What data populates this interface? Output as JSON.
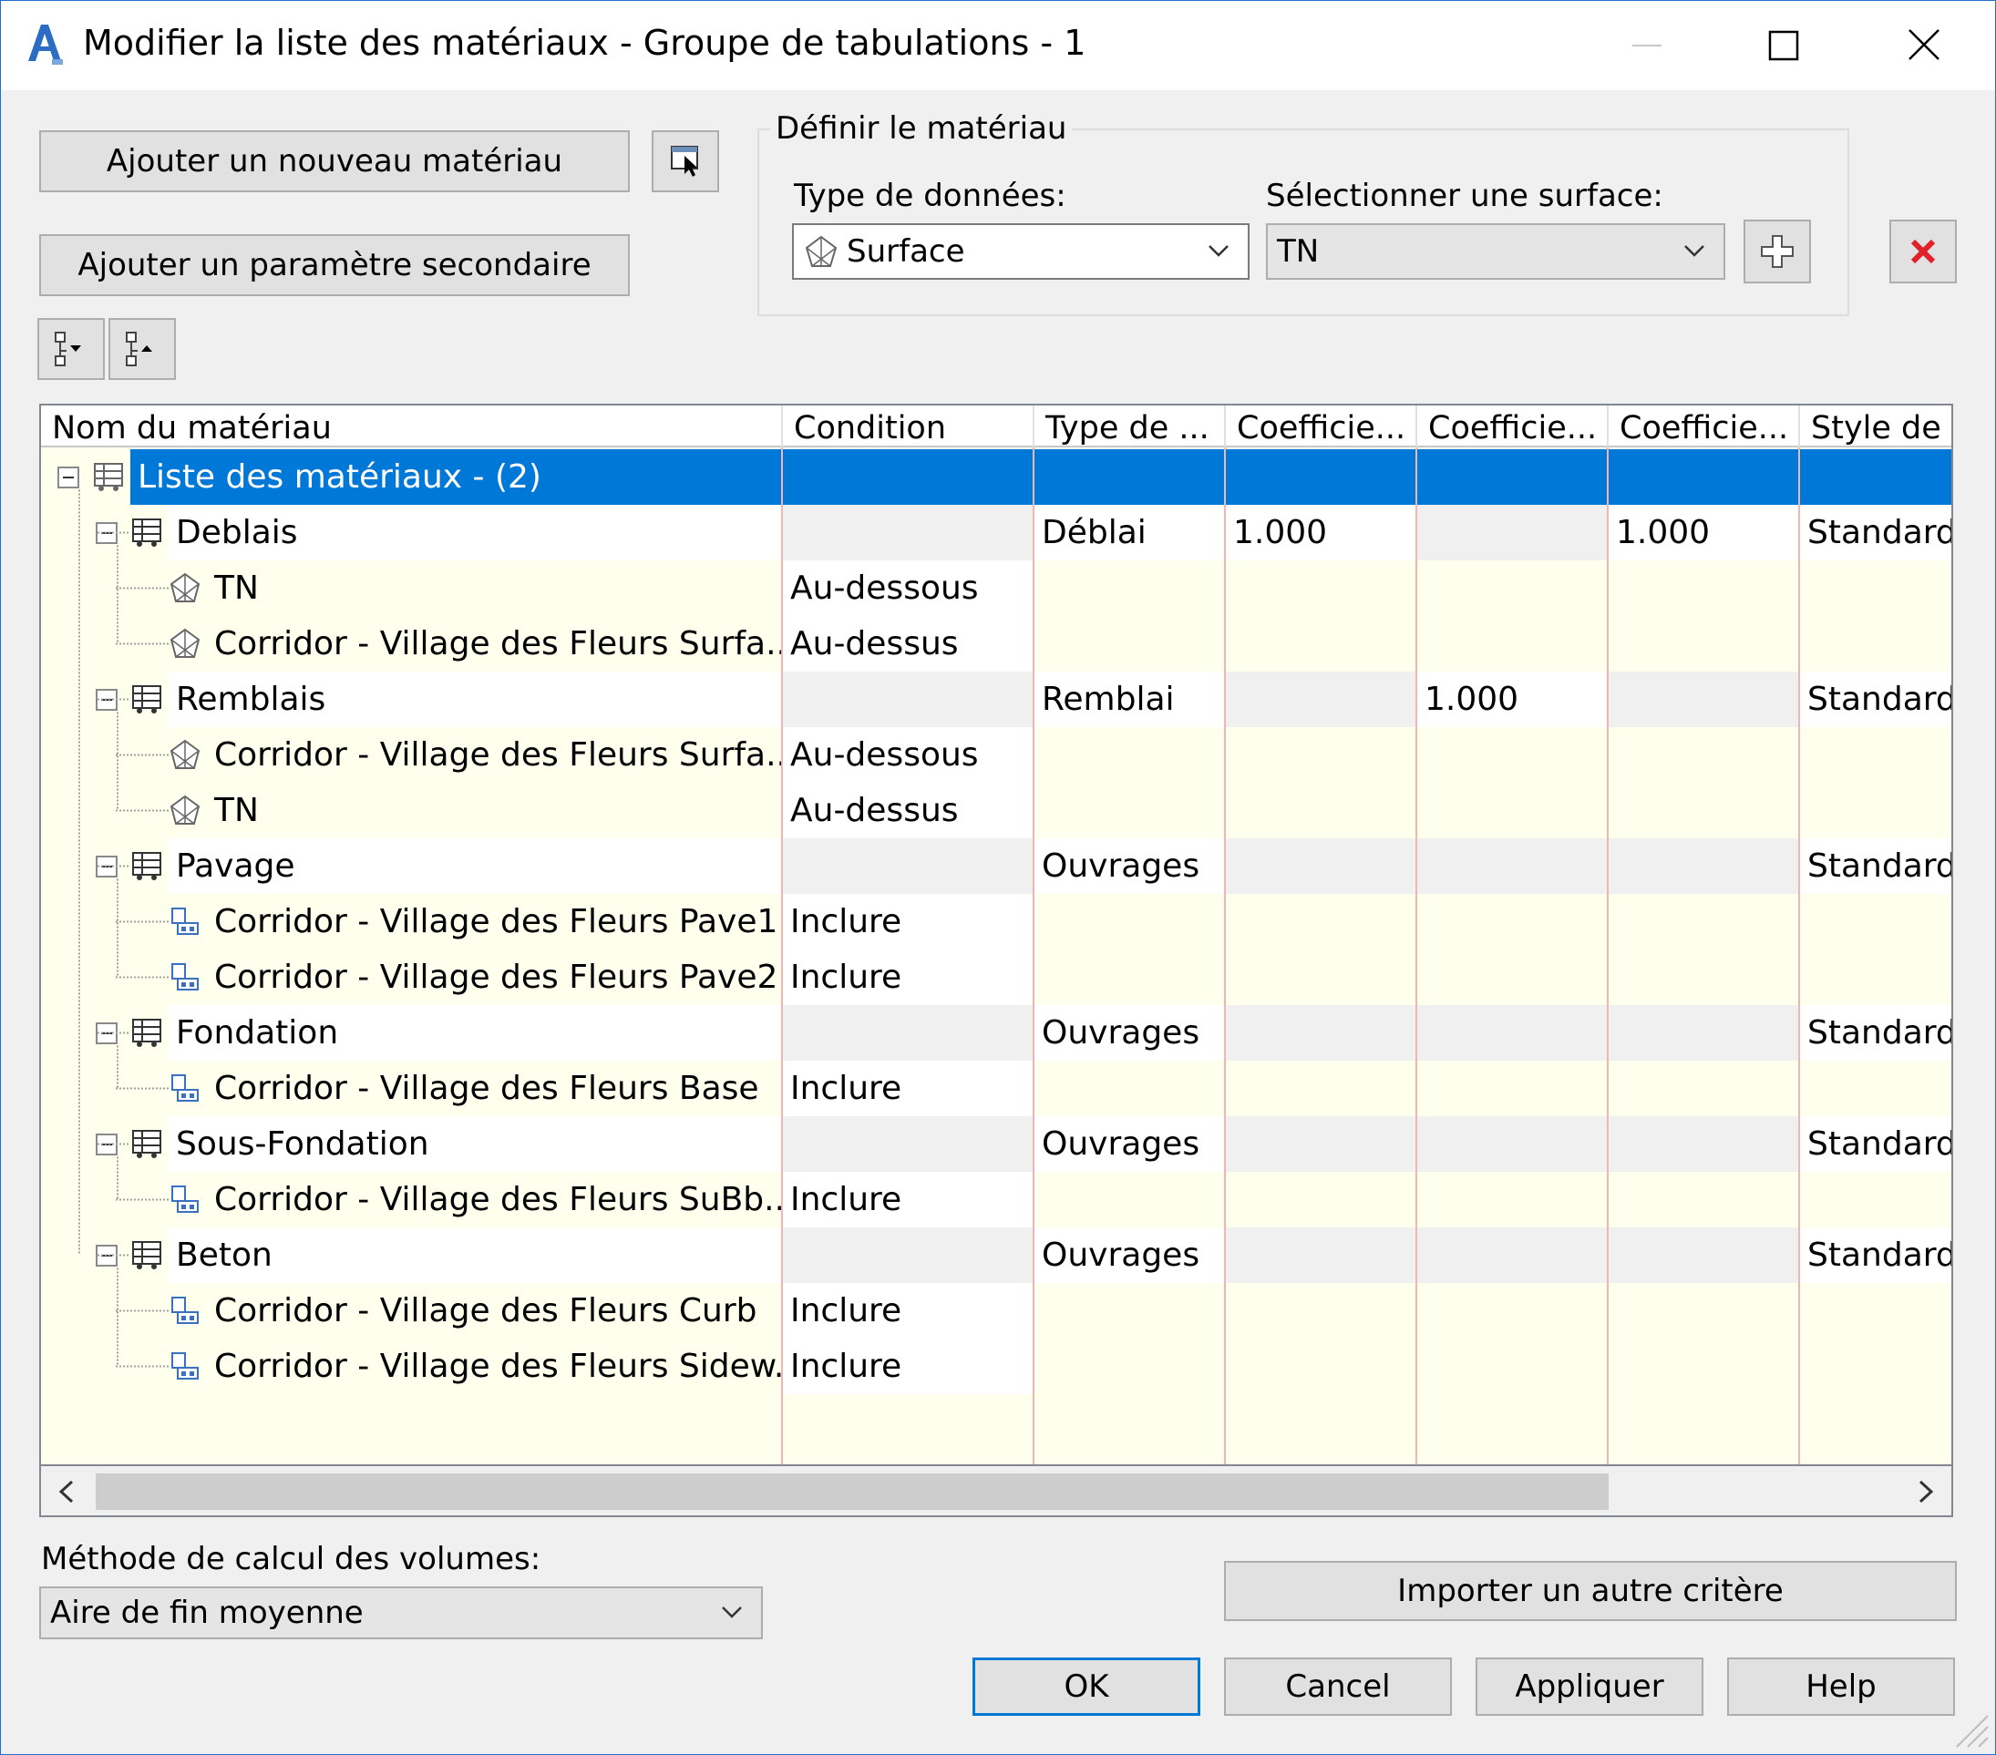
{
  "window": {
    "title": "Modifier la liste des matériaux - Groupe de tabulations - 1"
  },
  "toolbar": {
    "add_material_label": "Ajouter un nouveau matériau",
    "add_secondary_label": "Ajouter un paramètre secondaire"
  },
  "define_material": {
    "group_label": "Définir le matériau",
    "data_type_label": "Type de données:",
    "data_type_value": "Surface",
    "select_surface_label": "Sélectionner une surface:",
    "select_surface_value": "TN"
  },
  "grid": {
    "columns": [
      "Nom du matériau",
      "Condition",
      "Type de ...",
      "Coefficie...",
      "Coefficie...",
      "Coefficie...",
      "Style de ."
    ],
    "rows": [
      {
        "level": 0,
        "icon": "material-list-icon",
        "name": "Liste des matériaux - (2)",
        "condition": "",
        "type": "",
        "c1": "",
        "c2": "",
        "c3": "",
        "style": "",
        "selected": true
      },
      {
        "level": 1,
        "icon": "material-icon",
        "name": "Deblais",
        "condition": "",
        "type": "Déblai",
        "c1": "1.000",
        "c2": "",
        "c3": "1.000",
        "style": "Standard"
      },
      {
        "level": 2,
        "icon": "surface-icon",
        "name": "TN",
        "condition": "Au-dessous",
        "type": "",
        "c1": "",
        "c2": "",
        "c3": "",
        "style": ""
      },
      {
        "level": 2,
        "icon": "surface-icon",
        "name": "Corridor - Village des Fleurs Surfa...",
        "condition": "Au-dessus",
        "type": "",
        "c1": "",
        "c2": "",
        "c3": "",
        "style": ""
      },
      {
        "level": 1,
        "icon": "material-icon",
        "name": "Remblais",
        "condition": "",
        "type": "Remblai",
        "c1": "",
        "c2": "1.000",
        "c3": "",
        "style": "Standard"
      },
      {
        "level": 2,
        "icon": "surface-icon",
        "name": "Corridor - Village des Fleurs Surfa...",
        "condition": "Au-dessous",
        "type": "",
        "c1": "",
        "c2": "",
        "c3": "",
        "style": ""
      },
      {
        "level": 2,
        "icon": "surface-icon",
        "name": "TN",
        "condition": "Au-dessus",
        "type": "",
        "c1": "",
        "c2": "",
        "c3": "",
        "style": ""
      },
      {
        "level": 1,
        "icon": "material-icon",
        "name": "Pavage",
        "condition": "",
        "type": "Ouvrages",
        "c1": "",
        "c2": "",
        "c3": "",
        "style": "Standard"
      },
      {
        "level": 2,
        "icon": "corridor-shape-icon",
        "name": "Corridor - Village des Fleurs Pave1",
        "condition": "Inclure",
        "type": "",
        "c1": "",
        "c2": "",
        "c3": "",
        "style": ""
      },
      {
        "level": 2,
        "icon": "corridor-shape-icon",
        "name": "Corridor - Village des Fleurs Pave2",
        "condition": "Inclure",
        "type": "",
        "c1": "",
        "c2": "",
        "c3": "",
        "style": ""
      },
      {
        "level": 1,
        "icon": "material-icon",
        "name": "Fondation",
        "condition": "",
        "type": "Ouvrages",
        "c1": "",
        "c2": "",
        "c3": "",
        "style": "Standard"
      },
      {
        "level": 2,
        "icon": "corridor-shape-icon",
        "name": "Corridor - Village des Fleurs Base",
        "condition": "Inclure",
        "type": "",
        "c1": "",
        "c2": "",
        "c3": "",
        "style": ""
      },
      {
        "level": 1,
        "icon": "material-icon",
        "name": "Sous-Fondation",
        "condition": "",
        "type": "Ouvrages",
        "c1": "",
        "c2": "",
        "c3": "",
        "style": "Standard"
      },
      {
        "level": 2,
        "icon": "corridor-shape-icon",
        "name": "Corridor - Village des Fleurs SuBb...",
        "condition": "Inclure",
        "type": "",
        "c1": "",
        "c2": "",
        "c3": "",
        "style": ""
      },
      {
        "level": 1,
        "icon": "material-icon",
        "name": "Beton",
        "condition": "",
        "type": "Ouvrages",
        "c1": "",
        "c2": "",
        "c3": "",
        "style": "Standard"
      },
      {
        "level": 2,
        "icon": "corridor-shape-icon",
        "name": "Corridor - Village des Fleurs Curb",
        "condition": "Inclure",
        "type": "",
        "c1": "",
        "c2": "",
        "c3": "",
        "style": ""
      },
      {
        "level": 2,
        "icon": "corridor-shape-icon",
        "name": "Corridor - Village des Fleurs Sidew...",
        "condition": "Inclure",
        "type": "",
        "c1": "",
        "c2": "",
        "c3": "",
        "style": ""
      }
    ]
  },
  "volume_method": {
    "label": "Méthode de calcul des volumes:",
    "value": "Aire de fin moyenne"
  },
  "buttons": {
    "import_label": "Importer un autre critère",
    "ok_label": "OK",
    "cancel_label": "Cancel",
    "apply_label": "Appliquer",
    "help_label": "Help"
  },
  "colors": {
    "selection": "#0078d7",
    "grid_background": "#ffffee",
    "delete_red": "#e0202a"
  }
}
